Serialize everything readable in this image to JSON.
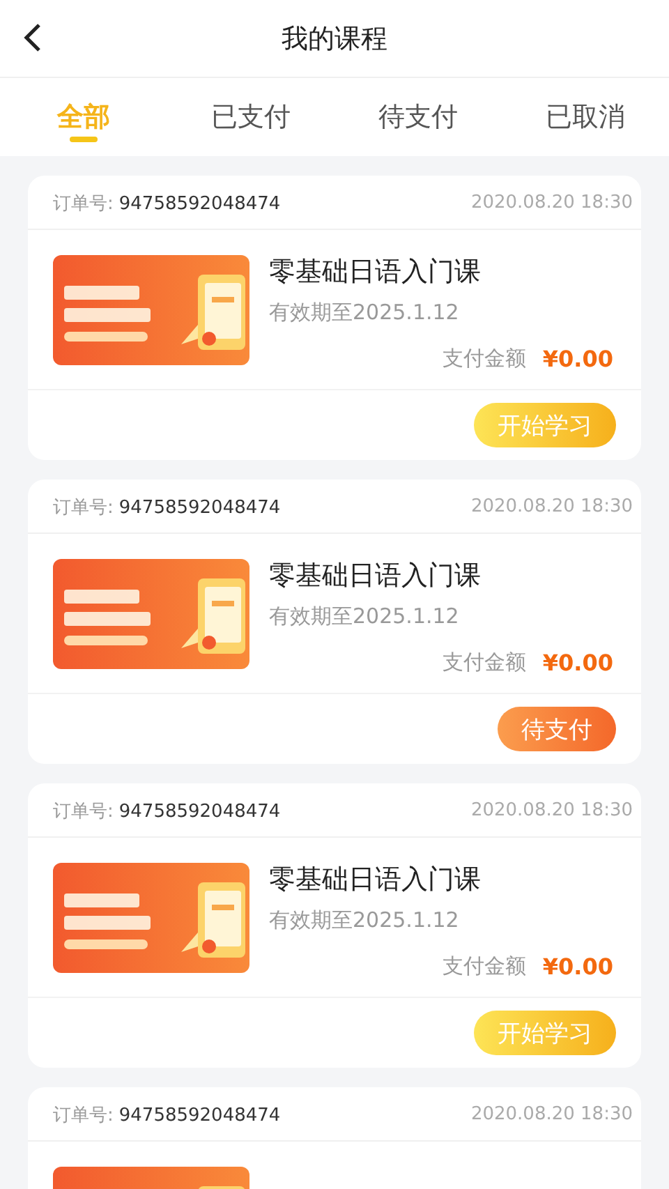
{
  "header": {
    "title": "我的课程"
  },
  "tabs": [
    {
      "label": "全部",
      "selected": true
    },
    {
      "label": "已支付",
      "selected": false
    },
    {
      "label": "待支付",
      "selected": false
    },
    {
      "label": "已取消",
      "selected": false
    }
  ],
  "orders": [
    {
      "order_label": "订单号:",
      "order_no": "94758592048474",
      "time": "2020.08.20 18:30",
      "title": "零基础日语入门课",
      "validity": "有效期至2025.1.12",
      "amount_label": "支付金额",
      "amount": "¥0.00",
      "action": {
        "label": "开始学习",
        "kind": "study"
      }
    },
    {
      "order_label": "订单号:",
      "order_no": "94758592048474",
      "time": "2020.08.20 18:30",
      "title": "零基础日语入门课",
      "validity": "有效期至2025.1.12",
      "amount_label": "支付金额",
      "amount": "¥0.00",
      "action": {
        "label": "待支付",
        "kind": "pay"
      }
    },
    {
      "order_label": "订单号:",
      "order_no": "94758592048474",
      "time": "2020.08.20 18:30",
      "title": "零基础日语入门课",
      "validity": "有效期至2025.1.12",
      "amount_label": "支付金额",
      "amount": "¥0.00",
      "action": {
        "label": "开始学习",
        "kind": "study"
      }
    },
    {
      "order_label": "订单号:",
      "order_no": "94758592048474",
      "time": "2020.08.20 18:30"
    }
  ]
}
